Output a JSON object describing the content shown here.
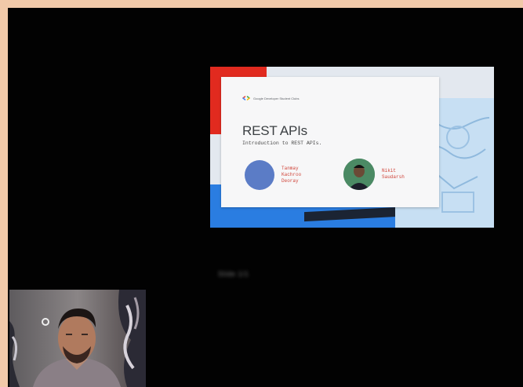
{
  "slide": {
    "org_label": "Google Developer Student Clubs",
    "title": "REST APIs",
    "subtitle": "Introduction to REST APIs.",
    "presenters": [
      {
        "name": "Tanmay Kachroo Deoray"
      },
      {
        "name": "Nikit Saudarsh"
      }
    ]
  },
  "caption": "Slide 1/1",
  "colors": {
    "page_background": "#f1c9a9",
    "screen_background": "#020202",
    "slide_red": "#e12a1f",
    "slide_blue": "#2a7de1",
    "presenter_name": "#d0453a"
  },
  "icons": {
    "gdsc_logo": "gdsc-logo-icon",
    "avatar_1": "avatar-circle",
    "avatar_2": "avatar-photo"
  }
}
